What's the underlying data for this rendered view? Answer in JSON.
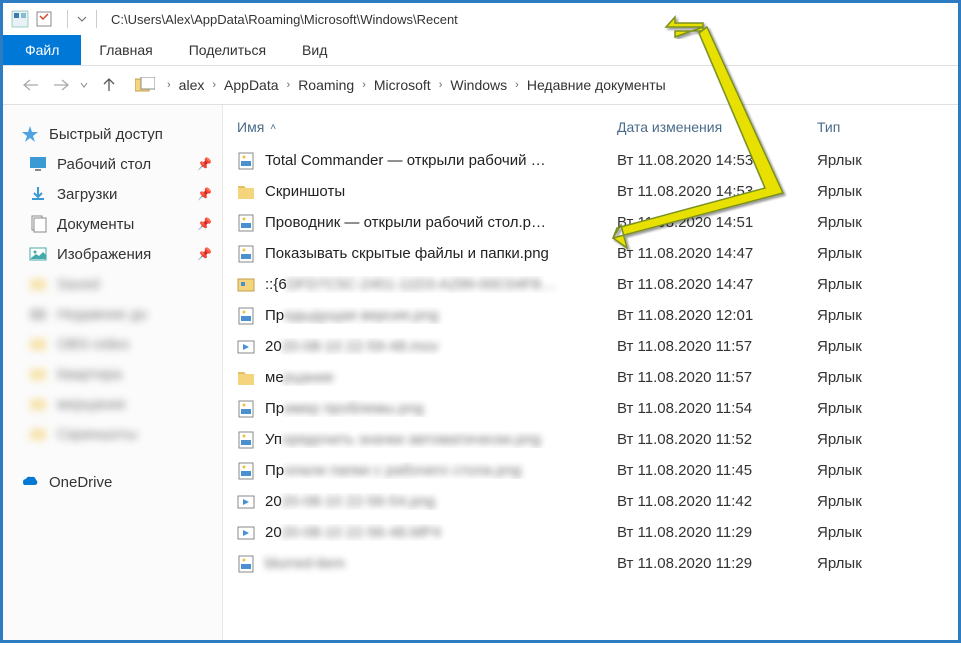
{
  "titlebar": {
    "path": "C:\\Users\\Alex\\AppData\\Roaming\\Microsoft\\Windows\\Recent"
  },
  "tabs": {
    "file": "Файл",
    "home": "Главная",
    "share": "Поделиться",
    "view": "Вид"
  },
  "breadcrumb": {
    "items": [
      "alex",
      "AppData",
      "Roaming",
      "Microsoft",
      "Windows",
      "Недавние документы"
    ]
  },
  "columns": {
    "name": "Имя",
    "date": "Дата изменения",
    "type": "Тип"
  },
  "sidebar": {
    "quick": "Быстрый доступ",
    "desktop": "Рабочий стол",
    "downloads": "Загрузки",
    "documents": "Документы",
    "pictures": "Изображения",
    "blur1": "Saved",
    "blur2": "Недавние до",
    "blur3": "OBS-video",
    "blur4": "Квартира",
    "blur5": "мерцание",
    "blur6": "Скриншоты",
    "onedrive": "OneDrive"
  },
  "files": [
    {
      "icon": "img",
      "name": "Total Commander — открыли рабочий …",
      "date": "Вт 11.08.2020 14:53",
      "type": "Ярлык",
      "blur": "none"
    },
    {
      "icon": "folder",
      "name": "Скриншоты",
      "date": "Вт 11.08.2020 14:53",
      "type": "Ярлык",
      "blur": "none"
    },
    {
      "icon": "img",
      "name": "Проводник — открыли рабочий стол.p…",
      "date": "Вт 11.08.2020 14:51",
      "type": "Ярлык",
      "blur": "none"
    },
    {
      "icon": "img",
      "name": "Показывать скрытые файлы и папки.png",
      "date": "Вт 11.08.2020 14:47",
      "type": "Ярлык",
      "blur": "none"
    },
    {
      "icon": "special",
      "prefix": "::{6",
      "blurred": "DFD7C5C-2451-11D3-A299-00C04F8…",
      "date": "Вт 11.08.2020 14:47",
      "type": "Ярлык",
      "blur": "partial"
    },
    {
      "icon": "img",
      "prefix": "Пр",
      "blurred": "едыдущая версия.png",
      "date": "Вт 11.08.2020 12:01",
      "type": "Ярлык",
      "blur": "partial"
    },
    {
      "icon": "video",
      "prefix": "20",
      "blurred": "20-08-10 22-59-48.mov",
      "date": "Вт 11.08.2020 11:57",
      "type": "Ярлык",
      "blur": "partial"
    },
    {
      "icon": "folder",
      "prefix": "ме",
      "blurred": "рцание",
      "date": "Вт 11.08.2020 11:57",
      "type": "Ярлык",
      "blur": "partial"
    },
    {
      "icon": "img",
      "prefix": "Пр",
      "blurred": "имер проблемы.png",
      "date": "Вт 11.08.2020 11:54",
      "type": "Ярлык",
      "blur": "partial"
    },
    {
      "icon": "img",
      "prefix": "Уп",
      "blurred": "орядочить значки автоматически.png",
      "date": "Вт 11.08.2020 11:52",
      "type": "Ярлык",
      "blur": "partial"
    },
    {
      "icon": "img",
      "prefix": "Пр",
      "blurred": "опали папки с рабочего стола.png",
      "date": "Вт 11.08.2020 11:45",
      "type": "Ярлык",
      "blur": "partial"
    },
    {
      "icon": "video",
      "prefix": "20",
      "blurred": "20-08-10 22-56-54.png",
      "date": "Вт 11.08.2020 11:42",
      "type": "Ярлык",
      "blur": "partial"
    },
    {
      "icon": "video",
      "prefix": "20",
      "blurred": "20-08-10 22-56-48.MP4",
      "date": "Вт 11.08.2020 11:29",
      "type": "Ярлык",
      "blur": "partial"
    },
    {
      "icon": "img",
      "name": "",
      "date": "Вт 11.08.2020 11:29",
      "type": "Ярлык",
      "blur": "full"
    }
  ]
}
